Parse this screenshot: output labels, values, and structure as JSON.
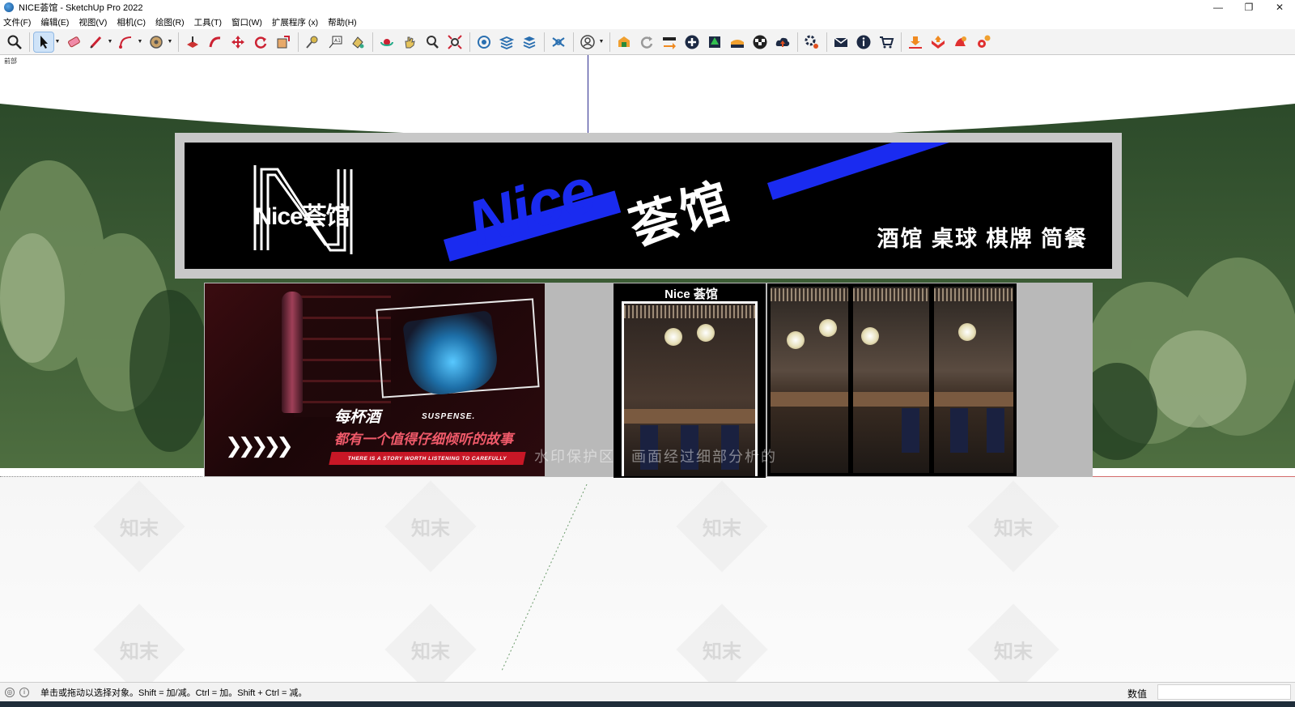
{
  "window": {
    "title": "NICE荟馆 - SketchUp Pro 2022",
    "minimize_glyph": "—",
    "restore_glyph": "❐",
    "close_glyph": "✕"
  },
  "menu": [
    {
      "label": "文件(F)"
    },
    {
      "label": "编辑(E)"
    },
    {
      "label": "视图(V)"
    },
    {
      "label": "相机(C)"
    },
    {
      "label": "绘图(R)"
    },
    {
      "label": "工具(T)"
    },
    {
      "label": "窗口(W)"
    },
    {
      "label": "扩展程序 (x)"
    },
    {
      "label": "帮助(H)"
    }
  ],
  "toolbar": {
    "icons": [
      "zoom-icon",
      "select-icon",
      "eraser-icon",
      "pencil-icon",
      "arc-icon",
      "tape-icon",
      "push-pull-icon",
      "follow-me-icon",
      "move-icon",
      "rotate-icon",
      "scale-icon",
      "measure-icon",
      "text-icon",
      "paint-icon",
      "orbit-icon",
      "pan-icon",
      "zoom-window-icon",
      "zoom-extents-icon",
      "section-icon",
      "layers-icon",
      "styles-icon",
      "user-icon",
      "warehouse-icon",
      "refresh-icon",
      "sync-icon",
      "add-icon",
      "tree-icon",
      "floor-icon",
      "checker-icon",
      "upload-icon",
      "settings-icon",
      "mail-icon",
      "info-icon",
      "cart-icon",
      "import-icon",
      "export-icon",
      "plugin-icon",
      "gear-icon"
    ]
  },
  "viewport": {
    "scene_label": "前部",
    "watermark_text": "知末",
    "watermark_line": "水印保护区　画面经过细部分析的"
  },
  "sign": {
    "logo_text": "Nice荟馆",
    "brand_en": "Nice",
    "brand_cn": "荟馆",
    "tagline": "酒馆 桌球 棋牌 简餐"
  },
  "poster": {
    "headline": "每杯酒",
    "tag": "SUSPENSE.",
    "subline": "都有一个值得仔细倾听的故事",
    "band": "THERE IS A STORY WORTH LISTENING TO CAREFULLY",
    "chevrons": "❯❯❯❯❯"
  },
  "door": {
    "label": "Nice 荟馆"
  },
  "statusbar": {
    "hint": "单击或拖动以选择对象。Shift = 加/减。Ctrl = 加。Shift + Ctrl = 减。",
    "measure_label": "数值"
  },
  "colors": {
    "brand_blue": "#1a2bf0",
    "sign_black": "#000000",
    "poster_red": "#c81726"
  }
}
